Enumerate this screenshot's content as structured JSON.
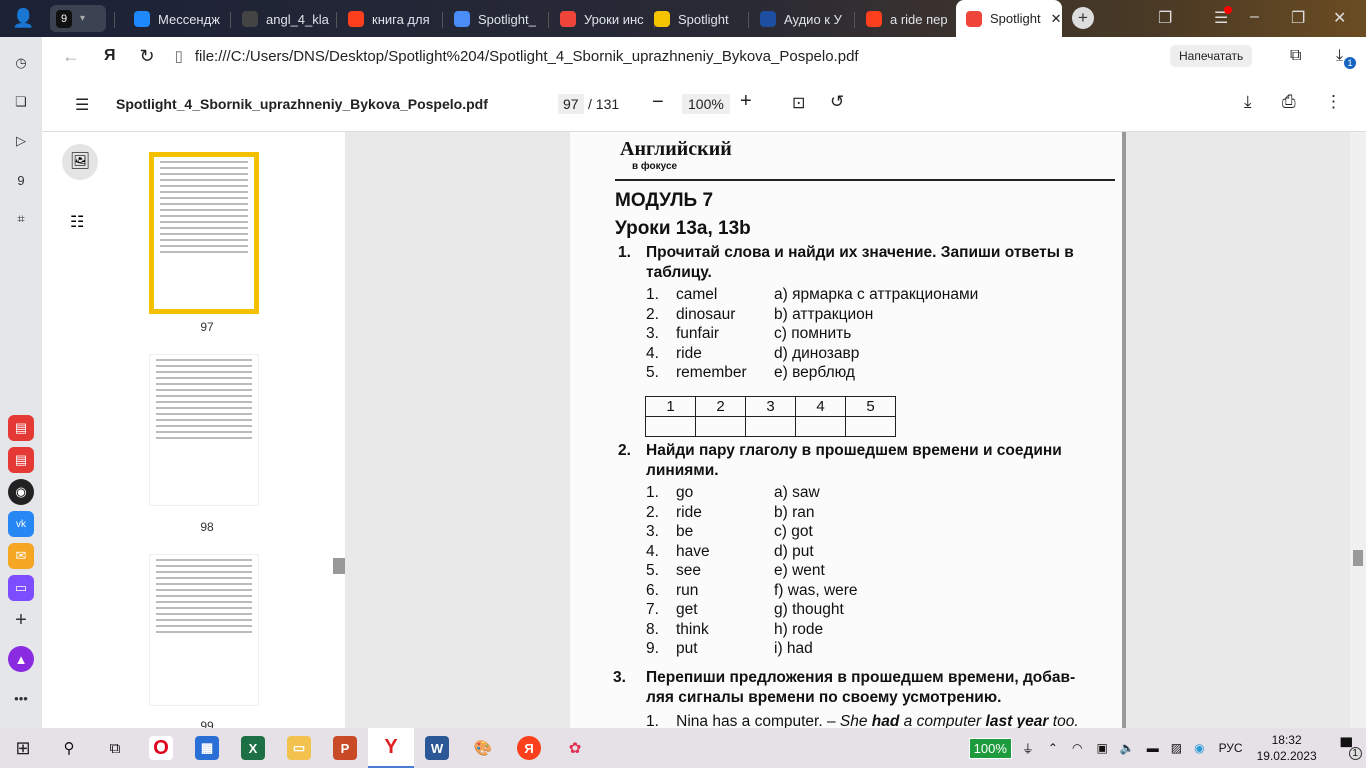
{
  "browser": {
    "tab_count": "9",
    "tabs": [
      {
        "label": "Мессендж",
        "icon": "messenger-icon",
        "color": "#1e88ff"
      },
      {
        "label": "angl_4_kla",
        "icon": "file-icon",
        "color": "#444"
      },
      {
        "label": "книга для",
        "icon": "yandex-icon",
        "color": "#fc3f1d"
      },
      {
        "label": "Spotlight_",
        "icon": "document-icon",
        "color": "#4a8df8"
      },
      {
        "label": "Уроки инс",
        "icon": "pdf-icon",
        "color": "#f0453a"
      },
      {
        "label": "Spotlight",
        "icon": "play-icon",
        "color": "#f5c400"
      },
      {
        "label": "Аудио к У",
        "icon": "university-icon",
        "color": "#1c4fa0"
      },
      {
        "label": "a ride пер",
        "icon": "yandex-icon",
        "color": "#fc3f1d"
      },
      {
        "label": "Spotlight",
        "icon": "pdf-icon",
        "color": "#f0453a",
        "active": true
      }
    ],
    "url": "file:///C:/Users/DNS/Desktop/Spotlight%204/Spotlight_4_Sbornik_uprazhneniy_Bykova_Pospelo.pdf",
    "print_button": "Напечатать",
    "downloads_badge": "1"
  },
  "pdf": {
    "filename": "Spotlight_4_Sbornik_uprazhneniy_Bykova_Pospelo.pdf",
    "current_page": "97",
    "total_pages": "/ 131",
    "zoom": "100%",
    "thumbnails": [
      "97",
      "98",
      "99"
    ]
  },
  "page": {
    "logo": "Английский в фокусе",
    "module": "МОДУЛЬ 7",
    "lessons": "Уроки 13a, 13b",
    "ex1": {
      "num": "1.",
      "title_line1": "Прочитай слова и найди их значение. Запиши ответы в",
      "title_line2": "таблицу.",
      "items": [
        [
          "1.",
          "camel",
          "a) ярмарка с аттракционами"
        ],
        [
          "2.",
          "dinosaur",
          "b) аттракцион"
        ],
        [
          "3.",
          "funfair",
          "c) помнить"
        ],
        [
          "4.",
          "ride",
          "d) динозавр"
        ],
        [
          "5.",
          "remember",
          "e) верблюд"
        ]
      ],
      "table_headers": [
        "1",
        "2",
        "3",
        "4",
        "5"
      ]
    },
    "ex2": {
      "num": "2.",
      "title_line1": "Найди пару глаголу в прошедшем времени и соедини",
      "title_line2": "линиями.",
      "items": [
        [
          "1.",
          "go",
          "a) saw"
        ],
        [
          "2.",
          "ride",
          "b) ran"
        ],
        [
          "3.",
          "be",
          "c) got"
        ],
        [
          "4.",
          "have",
          "d) put"
        ],
        [
          "5.",
          "see",
          "e) went"
        ],
        [
          "6.",
          "run",
          "f) was, were"
        ],
        [
          "7.",
          "get",
          "g) thought"
        ],
        [
          "8.",
          "think",
          "h) rode"
        ],
        [
          "9.",
          "put",
          "i) had"
        ]
      ]
    },
    "ex3": {
      "num": "3.",
      "title_line1": "Перепиши предложения в прошедшем времени, добав-",
      "title_line2": "ляя сигналы времени по своему усмотрению.",
      "example_num": "1.",
      "example_text": "Nina has a computer. –",
      "example_a": "She",
      "example_b": "had",
      "example_c": "a computer",
      "example_d": "last year",
      "example_e": "too."
    }
  },
  "taskbar": {
    "battery": "100%",
    "lang": "РУС",
    "time": "18:32",
    "date": "19.02.2023",
    "notifications": "1"
  }
}
